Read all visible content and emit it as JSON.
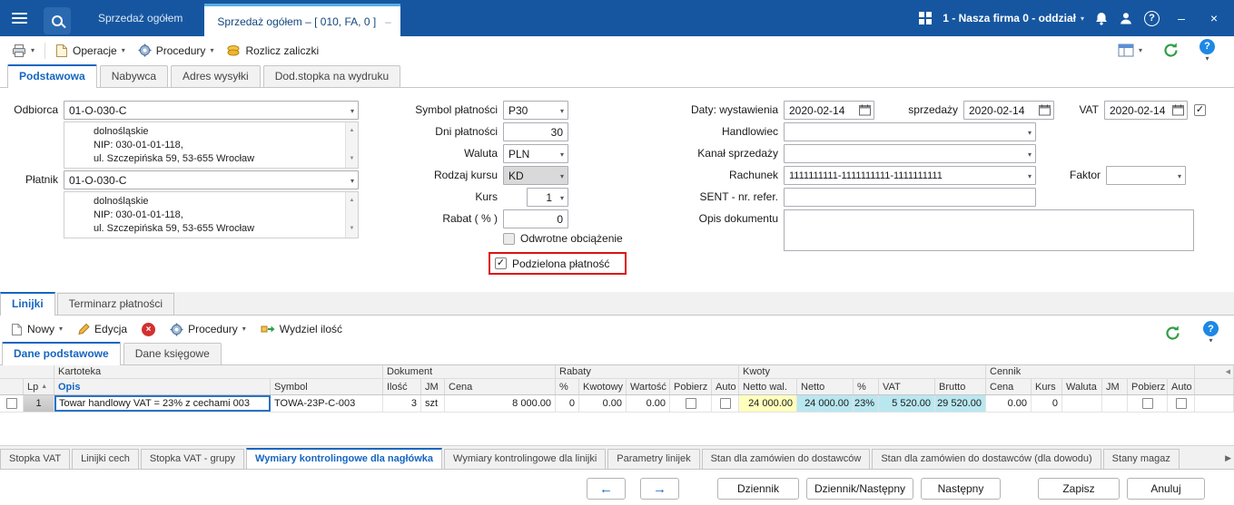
{
  "icons": {
    "caret_down": "▾",
    "close": "×",
    "minimize": "–",
    "check": "✓",
    "question": "?",
    "scroll_up": "▲",
    "scroll_down": "▼",
    "scroll_right": "▶",
    "scroll_left": "◀",
    "sort_asc": "▲",
    "arrow_prev": "←",
    "arrow_next": "→",
    "delete_x": "×"
  },
  "titlebar": {
    "doc_tab": "Sprzedaż ogółem",
    "active_tab": "Sprzedaż ogółem – [ 010, FA, 0 ]",
    "company_selector": "1 - Nasza firma 0 - oddział"
  },
  "toolbar": {
    "operacje": "Operacje",
    "procedury": "Procedury",
    "rozlicz_zaliczki": "Rozlicz zaliczki"
  },
  "header_tabs": [
    "Podstawowa",
    "Nabywca",
    "Adres wysyłki",
    "Dod.stopka na wydruku"
  ],
  "form": {
    "odbiorca": {
      "label": "Odbiorca",
      "value": "01-O-030-C",
      "addr_line1": "dolnośląskie",
      "addr_line2": "NIP: 030-01-01-118,",
      "addr_line3": "ul. Szczepińska 59, 53-655 Wrocław"
    },
    "platnik": {
      "label": "Płatnik",
      "value": "01-O-030-C",
      "addr_line1": "dolnośląskie",
      "addr_line2": "NIP: 030-01-01-118,",
      "addr_line3": "ul. Szczepińska 59, 53-655 Wrocław"
    },
    "symbol_platnosci": {
      "label": "Symbol płatności",
      "value": "P30"
    },
    "dni_platnosci": {
      "label": "Dni płatności",
      "value": "30"
    },
    "waluta": {
      "label": "Waluta",
      "value": "PLN"
    },
    "rodzaj_kursu": {
      "label": "Rodzaj kursu",
      "value": "KD"
    },
    "kurs": {
      "label": "Kurs",
      "value": "1"
    },
    "rabat": {
      "label": "Rabat ( % )",
      "value": "0"
    },
    "odwrotne_obciazenie_label": "Odwrotne obciążenie",
    "podzielona_platnosc_label": "Podzielona płatność",
    "daty_wystawienia": {
      "label": "Daty: wystawienia",
      "value": "2020-02-14"
    },
    "sprzedazy": {
      "label": "sprzedaży",
      "value": "2020-02-14"
    },
    "vat": {
      "label": "VAT",
      "value": "2020-02-14"
    },
    "handlowiec": {
      "label": "Handlowiec",
      "value": ""
    },
    "kanal_sprzedazy": {
      "label": "Kanał sprzedaży",
      "value": ""
    },
    "rachunek": {
      "label": "Rachunek",
      "value": "1111111111-1111111111-1111111111"
    },
    "faktor": {
      "label": "Faktor",
      "value": ""
    },
    "sent": {
      "label": "SENT - nr. refer.",
      "value": ""
    },
    "opis_dokumentu": {
      "label": "Opis dokumentu",
      "value": ""
    }
  },
  "lines": {
    "tabs": [
      "Linijki",
      "Terminarz płatności"
    ],
    "toolbar": {
      "nowy": "Nowy",
      "edycja": "Edycja",
      "procedury": "Procedury",
      "wydziel_ilosc": "Wydziel ilość"
    },
    "subtabs": [
      "Dane podstawowe",
      "Dane księgowe"
    ],
    "grid": {
      "groups": [
        "Kartoteka",
        "Dokument",
        "Rabaty",
        "Kwoty",
        "Cennik"
      ],
      "columns": [
        "Lp",
        "Opis",
        "Symbol",
        "Ilość",
        "JM",
        "Cena",
        "%",
        "Kwotowy",
        "Wartość",
        "Pobierz",
        "Auto",
        "Netto wal.",
        "Netto",
        "%",
        "VAT",
        "Brutto",
        "Cena",
        "Kurs",
        "Waluta",
        "JM",
        "Pobierz",
        "Auto"
      ],
      "row": {
        "lp": "1",
        "opis": "Towar handlowy VAT = 23% z cechami 003",
        "symbol": "TOWA-23P-C-003",
        "ilosc": "3",
        "jm": "szt",
        "cena": "8 000.00",
        "rabat_pct": "0",
        "kwotowy": "0.00",
        "wartosc": "0.00",
        "netto_wal": "24 000.00",
        "netto": "24 000.00",
        "vat_pct": "23%",
        "vat": "5 520.00",
        "brutto": "29 520.00",
        "cennik_cena": "0.00",
        "cennik_kurs": "0"
      }
    }
  },
  "bottom_tabs": [
    "Stopka VAT",
    "Linijki cech",
    "Stopka VAT - grupy",
    "Wymiary kontrolingowe dla nagłówka",
    "Wymiary kontrolingowe dla linijki",
    "Parametry linijek",
    "Stan dla zamówien do dostawców",
    "Stan dla zamówien do dostawców (dla dowodu)",
    "Stany magaz"
  ],
  "footer": {
    "dziennik": "Dziennik",
    "dziennik_nastepny": "Dziennik/Następny",
    "nastepny": "Następny",
    "zapisz": "Zapisz",
    "anuluj": "Anuluj"
  },
  "colors": {
    "titlebar_bg": "#1656a0",
    "accent_blue": "#1565c0",
    "highlight_red": "#dd1111",
    "cell_yellow": "#ffffbe",
    "cell_cyan": "#b9e7f0"
  }
}
